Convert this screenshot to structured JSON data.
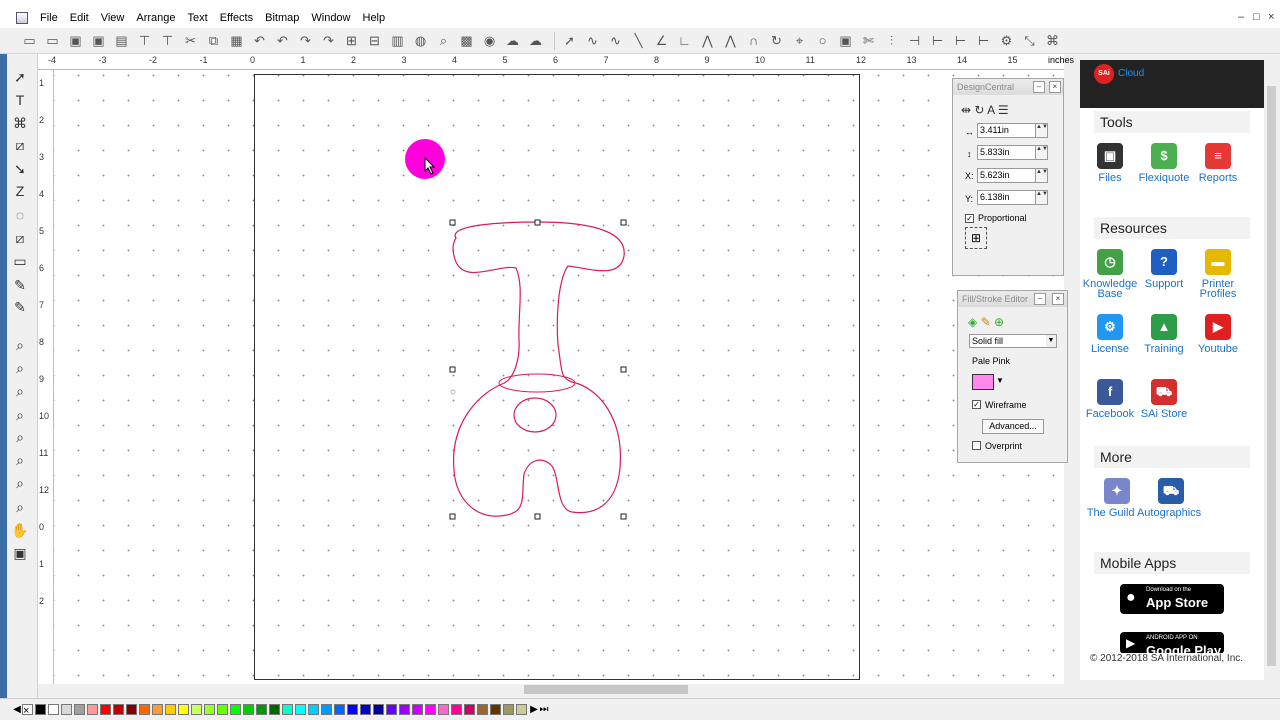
{
  "menu": [
    "File",
    "Edit",
    "View",
    "Arrange",
    "Text",
    "Effects",
    "Bitmap",
    "Window",
    "Help"
  ],
  "window_controls": [
    "–",
    "□",
    "×"
  ],
  "ruler": {
    "h_ticks": [
      "-4",
      "-3",
      "-2",
      "-1",
      "0",
      "1",
      "2",
      "3",
      "4",
      "5",
      "6",
      "7",
      "8",
      "9",
      "10",
      "11",
      "12",
      "13",
      "14",
      "15"
    ],
    "units": "inches",
    "v_ticks": [
      "1",
      "2",
      "3",
      "4",
      "5",
      "6",
      "7",
      "8",
      "9",
      "10",
      "11",
      "12",
      "0",
      "1",
      "2"
    ]
  },
  "design_central": {
    "title": "DesignCentral",
    "width": "3.411in",
    "height": "5.833in",
    "x_label": "X:",
    "x": "5.623in",
    "y_label": "Y:",
    "y": "6.138in",
    "proportional": "Proportional",
    "proportional_checked": true
  },
  "fill_stroke": {
    "title": "Fill/Stroke Editor",
    "fill_type": "Solid fill",
    "color_name": "Pale Pink",
    "color_hex": "#ff88ee",
    "wireframe": "Wireframe",
    "wireframe_checked": true,
    "advanced": "Advanced...",
    "overprint": "Overprint",
    "overprint_checked": false
  },
  "cloud": {
    "header": "Cloud",
    "logo": "SAi",
    "tools_title": "Tools",
    "tools": [
      {
        "label": "Files",
        "icon": "files-icon",
        "color": "#333333"
      },
      {
        "label": "Flexiquote",
        "icon": "flexiquote-icon",
        "color": "#4caf50"
      },
      {
        "label": "Reports",
        "icon": "reports-icon",
        "color": "#e53935"
      }
    ],
    "resources_title": "Resources",
    "resources": [
      {
        "label": "Knowledge Base",
        "icon": "knowledge-base-icon",
        "color": "#43a047"
      },
      {
        "label": "Support",
        "icon": "support-icon",
        "color": "#1e5fc4"
      },
      {
        "label": "Printer Profiles",
        "icon": "printer-profiles-icon",
        "color": "#e6b800"
      },
      {
        "label": "License",
        "icon": "license-icon",
        "color": "#2196f3"
      },
      {
        "label": "Training",
        "icon": "training-icon",
        "color": "#2e9d4a"
      },
      {
        "label": "Youtube",
        "icon": "youtube-icon",
        "color": "#e02020"
      },
      {
        "label": "Facebook",
        "icon": "facebook-icon",
        "color": "#3b5998"
      },
      {
        "label": "SAi Store",
        "icon": "sai-store-icon",
        "color": "#d32f2f"
      }
    ],
    "more_title": "More",
    "more": [
      {
        "label": "The Guild Autographics",
        "icon": "guild-icon",
        "color": "#7986cb"
      }
    ],
    "mobile_title": "Mobile Apps",
    "app_store_top": "Download on the",
    "app_store": "App Store",
    "google_play_top": "ANDROID APP ON",
    "google_play": "Google Play",
    "copyright": "© 2012-2018 SA International, Inc."
  },
  "palette_colors": [
    "#000000",
    "#ffffff",
    "#d9d9d9",
    "#a0a0a0",
    "#ff9999",
    "#ff0000",
    "#c00000",
    "#800000",
    "#ff6600",
    "#ff9933",
    "#ffcc00",
    "#ffff00",
    "#ccff66",
    "#99ff33",
    "#66ff00",
    "#00ff00",
    "#00cc00",
    "#009900",
    "#006600",
    "#00ffcc",
    "#00ffff",
    "#00ccff",
    "#0099ff",
    "#0066ff",
    "#0000ff",
    "#0000cc",
    "#000099",
    "#6600ff",
    "#9900ff",
    "#cc00ff",
    "#ff00ff",
    "#ff66cc",
    "#ff0099",
    "#cc0066",
    "#996633",
    "#663300",
    "#999966",
    "#cccc99"
  ]
}
